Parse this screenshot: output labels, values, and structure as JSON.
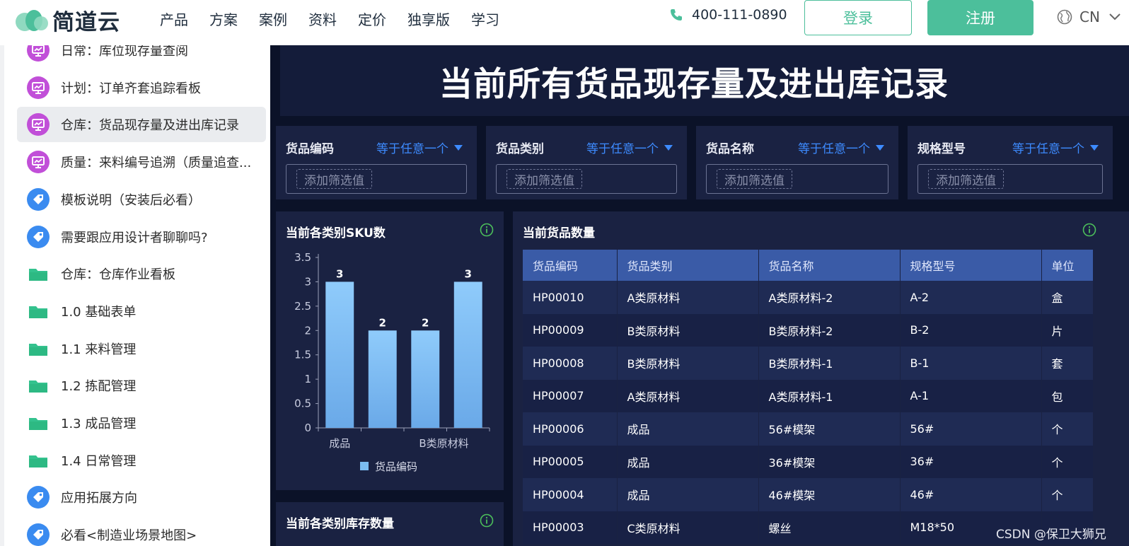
{
  "header": {
    "logo_text": "简道云",
    "nav": [
      "产品",
      "方案",
      "案例",
      "资料",
      "定价",
      "独享版",
      "学习"
    ],
    "phone": "400-111-0890",
    "login": "登录",
    "signup": "注册",
    "lang": "CN",
    "brand_color": "#4cbf9b"
  },
  "sidebar": {
    "items": [
      {
        "label": "日常：库位现存量查阅",
        "icon": "dashboard-icon"
      },
      {
        "label": "计划：订单齐套追踪看板",
        "icon": "dashboard-icon"
      },
      {
        "label": "仓库：货品现存量及进出库记录",
        "icon": "dashboard-icon",
        "active": true
      },
      {
        "label": "质量：来料编号追溯（质量追查...",
        "icon": "dashboard-icon"
      },
      {
        "label": "模板说明（安装后必看）",
        "icon": "tag-icon"
      },
      {
        "label": "需要跟应用设计者聊聊吗?",
        "icon": "tag-icon"
      },
      {
        "label": "仓库：仓库作业看板",
        "icon": "folder-icon"
      },
      {
        "label": "1.0 基础表单",
        "icon": "folder-icon"
      },
      {
        "label": "1.1 来料管理",
        "icon": "folder-icon"
      },
      {
        "label": "1.2 拣配管理",
        "icon": "folder-icon"
      },
      {
        "label": "1.3 成品管理",
        "icon": "folder-icon"
      },
      {
        "label": "1.4 日常管理",
        "icon": "folder-icon"
      },
      {
        "label": "应用拓展方向",
        "icon": "tag-icon"
      },
      {
        "label": "必看<制造业场景地图>",
        "icon": "tag-icon"
      }
    ]
  },
  "dashboard": {
    "title": "当前所有货品现存量及进出库记录",
    "filters": [
      {
        "label": "货品编码",
        "op": "等于任意一个",
        "placeholder": "添加筛选值"
      },
      {
        "label": "货品类别",
        "op": "等于任意一个",
        "placeholder": "添加筛选值"
      },
      {
        "label": "货品名称",
        "op": "等于任意一个",
        "placeholder": "添加筛选值"
      },
      {
        "label": "规格型号",
        "op": "等于任意一个",
        "placeholder": "添加筛选值"
      }
    ],
    "sku_panel_title": "当前各类别SKU数",
    "stock_panel_title": "当前各类别库存数量",
    "table_panel_title": "当前货品数量",
    "table": {
      "headers": [
        "货品编码",
        "货品类别",
        "货品名称",
        "规格型号",
        "单位"
      ],
      "rows": [
        [
          "HP00010",
          "A类原材料",
          "A类原材料-2",
          "A-2",
          "盒"
        ],
        [
          "HP00009",
          "B类原材料",
          "B类原材料-2",
          "B-2",
          "片"
        ],
        [
          "HP00008",
          "B类原材料",
          "B类原材料-1",
          "B-1",
          "套"
        ],
        [
          "HP00007",
          "A类原材料",
          "A类原材料-1",
          "A-1",
          "包"
        ],
        [
          "HP00006",
          "成品",
          "56#模架",
          "56#",
          "个"
        ],
        [
          "HP00005",
          "成品",
          "36#模架",
          "36#",
          "个"
        ],
        [
          "HP00004",
          "成品",
          "46#模架",
          "46#",
          "个"
        ],
        [
          "HP00003",
          "C类原材料",
          "螺丝",
          "M18*50",
          ""
        ]
      ]
    }
  },
  "chart_data": {
    "type": "bar",
    "categories": [
      "成品",
      "",
      "B类原材料",
      ""
    ],
    "series": [
      {
        "name": "货品编码",
        "values": [
          3,
          2,
          2,
          3
        ]
      }
    ],
    "ylim": [
      0,
      3.5
    ],
    "yticks": [
      "0",
      "0.5",
      "1",
      "1.5",
      "2",
      "2.5",
      "3",
      "3.5"
    ],
    "legend": "bottom",
    "bar_color": "#7bbcf0"
  },
  "watermark": "CSDN @保卫大狮兄"
}
